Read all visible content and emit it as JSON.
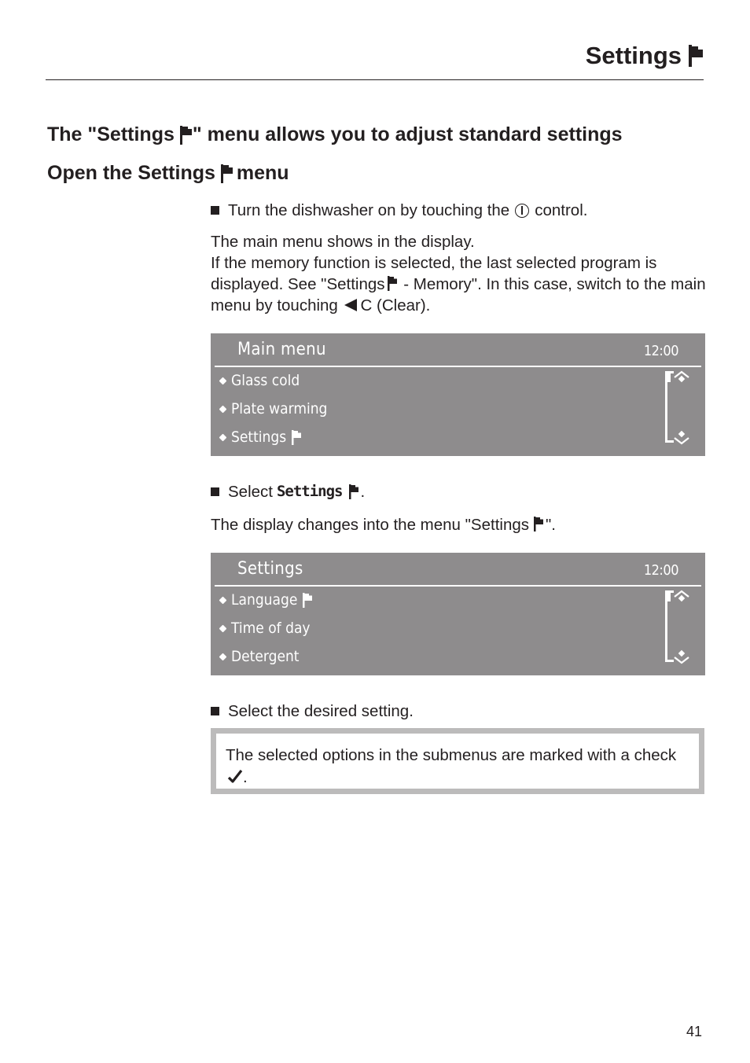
{
  "header": {
    "title": "Settings",
    "title_icon": "flag-icon"
  },
  "section_heading": {
    "prefix": "The \"Settings",
    "suffix": "\" menu allows you to adjust standard settings",
    "icon": "flag-icon"
  },
  "subheading": {
    "prefix": "Open the Settings",
    "suffix": "menu",
    "icon": "flag-icon"
  },
  "step1": {
    "text_before": "Turn the dishwasher on by touching the",
    "icon": "power-icon",
    "text_after": "control."
  },
  "paragraph1": {
    "line1": "The main menu shows in the display.",
    "text_before_flag": "If the memory function is selected, the last selected program is displayed. See \"Settings",
    "text_between": "- Memory\". In this case, switch to the main menu by touching",
    "arrow_icon": "triangle-left-icon",
    "text_after": "C (Clear)."
  },
  "display_main": {
    "title": "Main menu",
    "time": "12:00",
    "items": [
      {
        "label": "Glass cold",
        "flag": false
      },
      {
        "label": "Plate warming",
        "flag": false
      },
      {
        "label": "Settings",
        "flag": true
      }
    ],
    "scroll_position": 0
  },
  "step2": {
    "text_before": "Select",
    "lcd_text": "Settings",
    "text_after": "."
  },
  "paragraph2": {
    "text_before": "The display changes into the menu \"Settings",
    "text_after": "\"."
  },
  "display_settings": {
    "title": "Settings",
    "time": "12:00",
    "items": [
      {
        "label": "Language",
        "flag": true
      },
      {
        "label": "Time of day",
        "flag": false
      },
      {
        "label": "Detergent",
        "flag": false
      }
    ],
    "scroll_position": 0
  },
  "step3": {
    "text": "Select the desired setting."
  },
  "note": {
    "text": "The selected options in the submenus are marked with a check",
    "icon": "check-icon",
    "text_after": "."
  },
  "page_number": "41",
  "colors": {
    "text": "#231f20",
    "lcd_background": "#8e8c8d",
    "lcd_text": "#ffffff",
    "note_border": "#bcbbbb"
  }
}
